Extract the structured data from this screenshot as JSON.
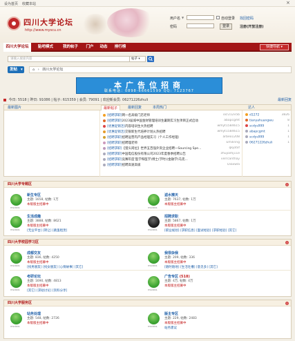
{
  "topbar": {
    "set_home": "设为首页",
    "bookmark": "收藏本站",
    "close": "×"
  },
  "site": {
    "title": "四川大学论坛",
    "url": "http://www.myscu.cn"
  },
  "login": {
    "user_label": "用户名",
    "user_select": "▼",
    "pwd_label": "密码",
    "auto_login": "自动登录",
    "find_pwd": "找回密码",
    "login_btn": "登录",
    "register": "注册(开放注册)"
  },
  "nav": {
    "items": [
      "四川大学论坛",
      "贴吧模式",
      "我的帖子",
      "门户",
      "动态",
      "排行榜"
    ],
    "quick": "快捷导航 ▾"
  },
  "search": {
    "placeholder": "请输入搜索内容",
    "type": "帖子 ▾"
  },
  "post": {
    "label": "发帖",
    "arrow": "▾"
  },
  "breadcrumb": {
    "home": "⌂",
    "sep": "›",
    "current": "四川大学论坛"
  },
  "banner": {
    "title": "本广告位招商",
    "sub": "联系电话：0898-66661599 QQ: 7123767"
  },
  "stats": {
    "text": "今日: 5518 | 昨日: 91086 | 帖子: 615359 | 会员: 79091 | 欢迎新会员: 06271226zhuli",
    "latest": "最新回复"
  },
  "newest": {
    "tab_img": "最新图片",
    "tabs": [
      "最新帖子",
      "最新回复",
      "本周热门"
    ],
    "rank": "达人",
    "posts": [
      {
        "tag": "[招聘求职]",
        "title": "网一名高级门店老师",
        "author": "ocr212v5b"
      },
      {
        "tag": "[招聘求职]",
        "title": "2023届城中国金财管理培训生暑期实习生项目正式启动",
        "author": "abapcgmt"
      },
      {
        "tag": "[优惠促销活]",
        "title": "内容培训生大热招聘",
        "author": "wmyt1584615"
      },
      {
        "tag": "[优惠促销活]",
        "title": "交银新生代培养计划火热招聘",
        "author": "wmyt1584615"
      },
      {
        "tag": "[招聘求职]",
        "title": "招聘运营内产品经理实习（个人工作经理）",
        "author": "arbeo1208"
      },
      {
        "tag": "[招聘求职]",
        "title": "招聘理老师",
        "author": "Emilinng"
      },
      {
        "tag": "[招聘求职]",
        "title": "【猎头岗位】世界五百强外资企业招聘一Sourcing Spe...",
        "author": "qkjotxf"
      },
      {
        "tag": "[招聘求职]",
        "title": "中国电信股份有限公司2023年度春季招聘公告",
        "author": "zhujiamj11e"
      },
      {
        "tag": "[招聘求职]",
        "title": "竞赛年度'医学和医学)博士(学时)(金融学)马克...",
        "author": "verrcanthay"
      },
      {
        "tag": "[招聘求职]",
        "title": "招聘高速高级",
        "author": "Diaxwla"
      }
    ],
    "ranking": [
      {
        "name": "d1272",
        "score": "3826"
      },
      {
        "name": "tianyahuangwu",
        "score": "8"
      },
      {
        "name": "scdys999",
        "score": "1"
      },
      {
        "name": "abapcgmt",
        "score": "1"
      },
      {
        "name": "scdys999",
        "score": "1"
      },
      {
        "name": "06271226zhuli",
        "score": "1"
      }
    ]
  },
  "sections": [
    {
      "title": "四川大学专题区",
      "forums": [
        {
          "name": "新生专区",
          "stat": "主题: 1658, 帖数: 1万",
          "mod": "本版版主招募中",
          "dark": false
        },
        {
          "name": "滤水擦天",
          "stat": "主题: 7637, 帖数: 1万",
          "mod": "本版版主招募中",
          "dark": false
        },
        {
          "name": "生活成趣",
          "stat": "主题: 3888, 帖数: 8621",
          "mod": "本版版主招募中",
          "sub": "[无业平台] [转让] [跳蚤租赁]",
          "dark": false
        },
        {
          "name": "招聘求职",
          "stat": "主题: 5867, 帖数: 1万",
          "mod": "本版版主招募中",
          "sub": "[职业规划] [求职信息] [面试经验] [求职经验] [其它]",
          "dark": true
        }
      ]
    },
    {
      "title": "四川大学校园学习区",
      "forums": [
        {
          "name": "成都交友",
          "stat": "主题: 836, 帖数: 4250",
          "mod": "本版版主招募中",
          "sub": "[找男朋友] [找女朋友] [心情故事] [其它]",
          "dark": false
        },
        {
          "name": "我很杂我",
          "stat": "主题: 209, 帖数: 336",
          "mod": "本版版主招募中",
          "sub": "[随时随地] [生活吐槽] [意见多] [其它]",
          "dark": false
        },
        {
          "name": "考研论坛",
          "stat": "主题: 1690, 帖数: 4813",
          "mod": "本版版主招募中",
          "sub": "[其它] [求助讨论] [资料分享]",
          "dark": false
        },
        {
          "name": "广告专区",
          "count": "(518)",
          "stat": "主题: 4万, 帖数: 4万",
          "mod": "本版版主招募中",
          "dark": false
        }
      ]
    },
    {
      "title": "四川大学服务区",
      "forums": [
        {
          "name": "站务处理",
          "stat": "主题: 548, 帖数: 2726",
          "mod": "本版版主招募中",
          "dark": false
        },
        {
          "name": "版主专区",
          "stat": "主题: 229, 帖数: 2483",
          "mod": "本版版主招募中",
          "sub": "站务建议",
          "dark": false
        }
      ]
    }
  ],
  "icon_caption": "mscbbs",
  "colors": {
    "brand": "#a31616",
    "link": "#1f5fa8",
    "accent": "#2b8ed8"
  }
}
